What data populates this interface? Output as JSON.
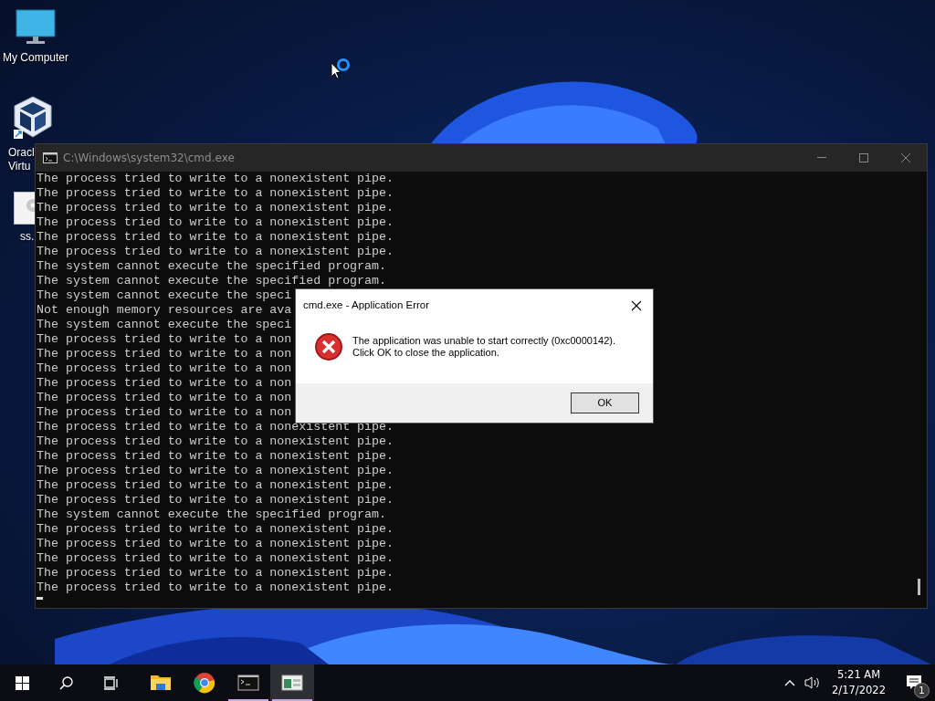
{
  "desktop_icons": [
    {
      "kind": "computer",
      "label_lines": [
        "My Computer"
      ]
    },
    {
      "kind": "cube",
      "label_lines": [
        "Oracl",
        "Virtu"
      ]
    },
    {
      "kind": "file",
      "label_lines": [
        "ss."
      ]
    }
  ],
  "console_window": {
    "title": "C:\\Windows\\system32\\cmd.exe",
    "active": false,
    "lines": [
      "The process tried to write to a nonexistent pipe.",
      "The process tried to write to a nonexistent pipe.",
      "The process tried to write to a nonexistent pipe.",
      "The process tried to write to a nonexistent pipe.",
      "The process tried to write to a nonexistent pipe.",
      "The process tried to write to a nonexistent pipe.",
      "The system cannot execute the specified program.",
      "The system cannot execute the specified program.",
      "The system cannot execute the speci",
      "Not enough memory resources are ava",
      "The system cannot execute the speci",
      "The process tried to write to a non",
      "The process tried to write to a non",
      "The process tried to write to a non",
      "The process tried to write to a non",
      "The process tried to write to a non",
      "The process tried to write to a non",
      "The process tried to write to a nonexistent pipe.",
      "The process tried to write to a nonexistent pipe.",
      "The process tried to write to a nonexistent pipe.",
      "The process tried to write to a nonexistent pipe.",
      "The process tried to write to a nonexistent pipe.",
      "The process tried to write to a nonexistent pipe.",
      "The system cannot execute the specified program.",
      "The process tried to write to a nonexistent pipe.",
      "The process tried to write to a nonexistent pipe.",
      "The process tried to write to a nonexistent pipe.",
      "The process tried to write to a nonexistent pipe.",
      "The process tried to write to a nonexistent pipe."
    ]
  },
  "error_dialog": {
    "title": "cmd.exe - Application Error",
    "message_lines": [
      "The application was unable to start correctly (0xc0000142).",
      "Click OK to close the application."
    ],
    "button": "OK"
  },
  "taskbar": {
    "apps": [
      {
        "kind": "folder",
        "running": false,
        "selected": false
      },
      {
        "kind": "browser",
        "running": false,
        "selected": false
      },
      {
        "kind": "terminal",
        "running": true,
        "selected": false
      },
      {
        "kind": "window",
        "running": true,
        "selected": true
      }
    ],
    "time": "5:21 AM",
    "date": "2/17/2022",
    "notification_count": "1"
  }
}
